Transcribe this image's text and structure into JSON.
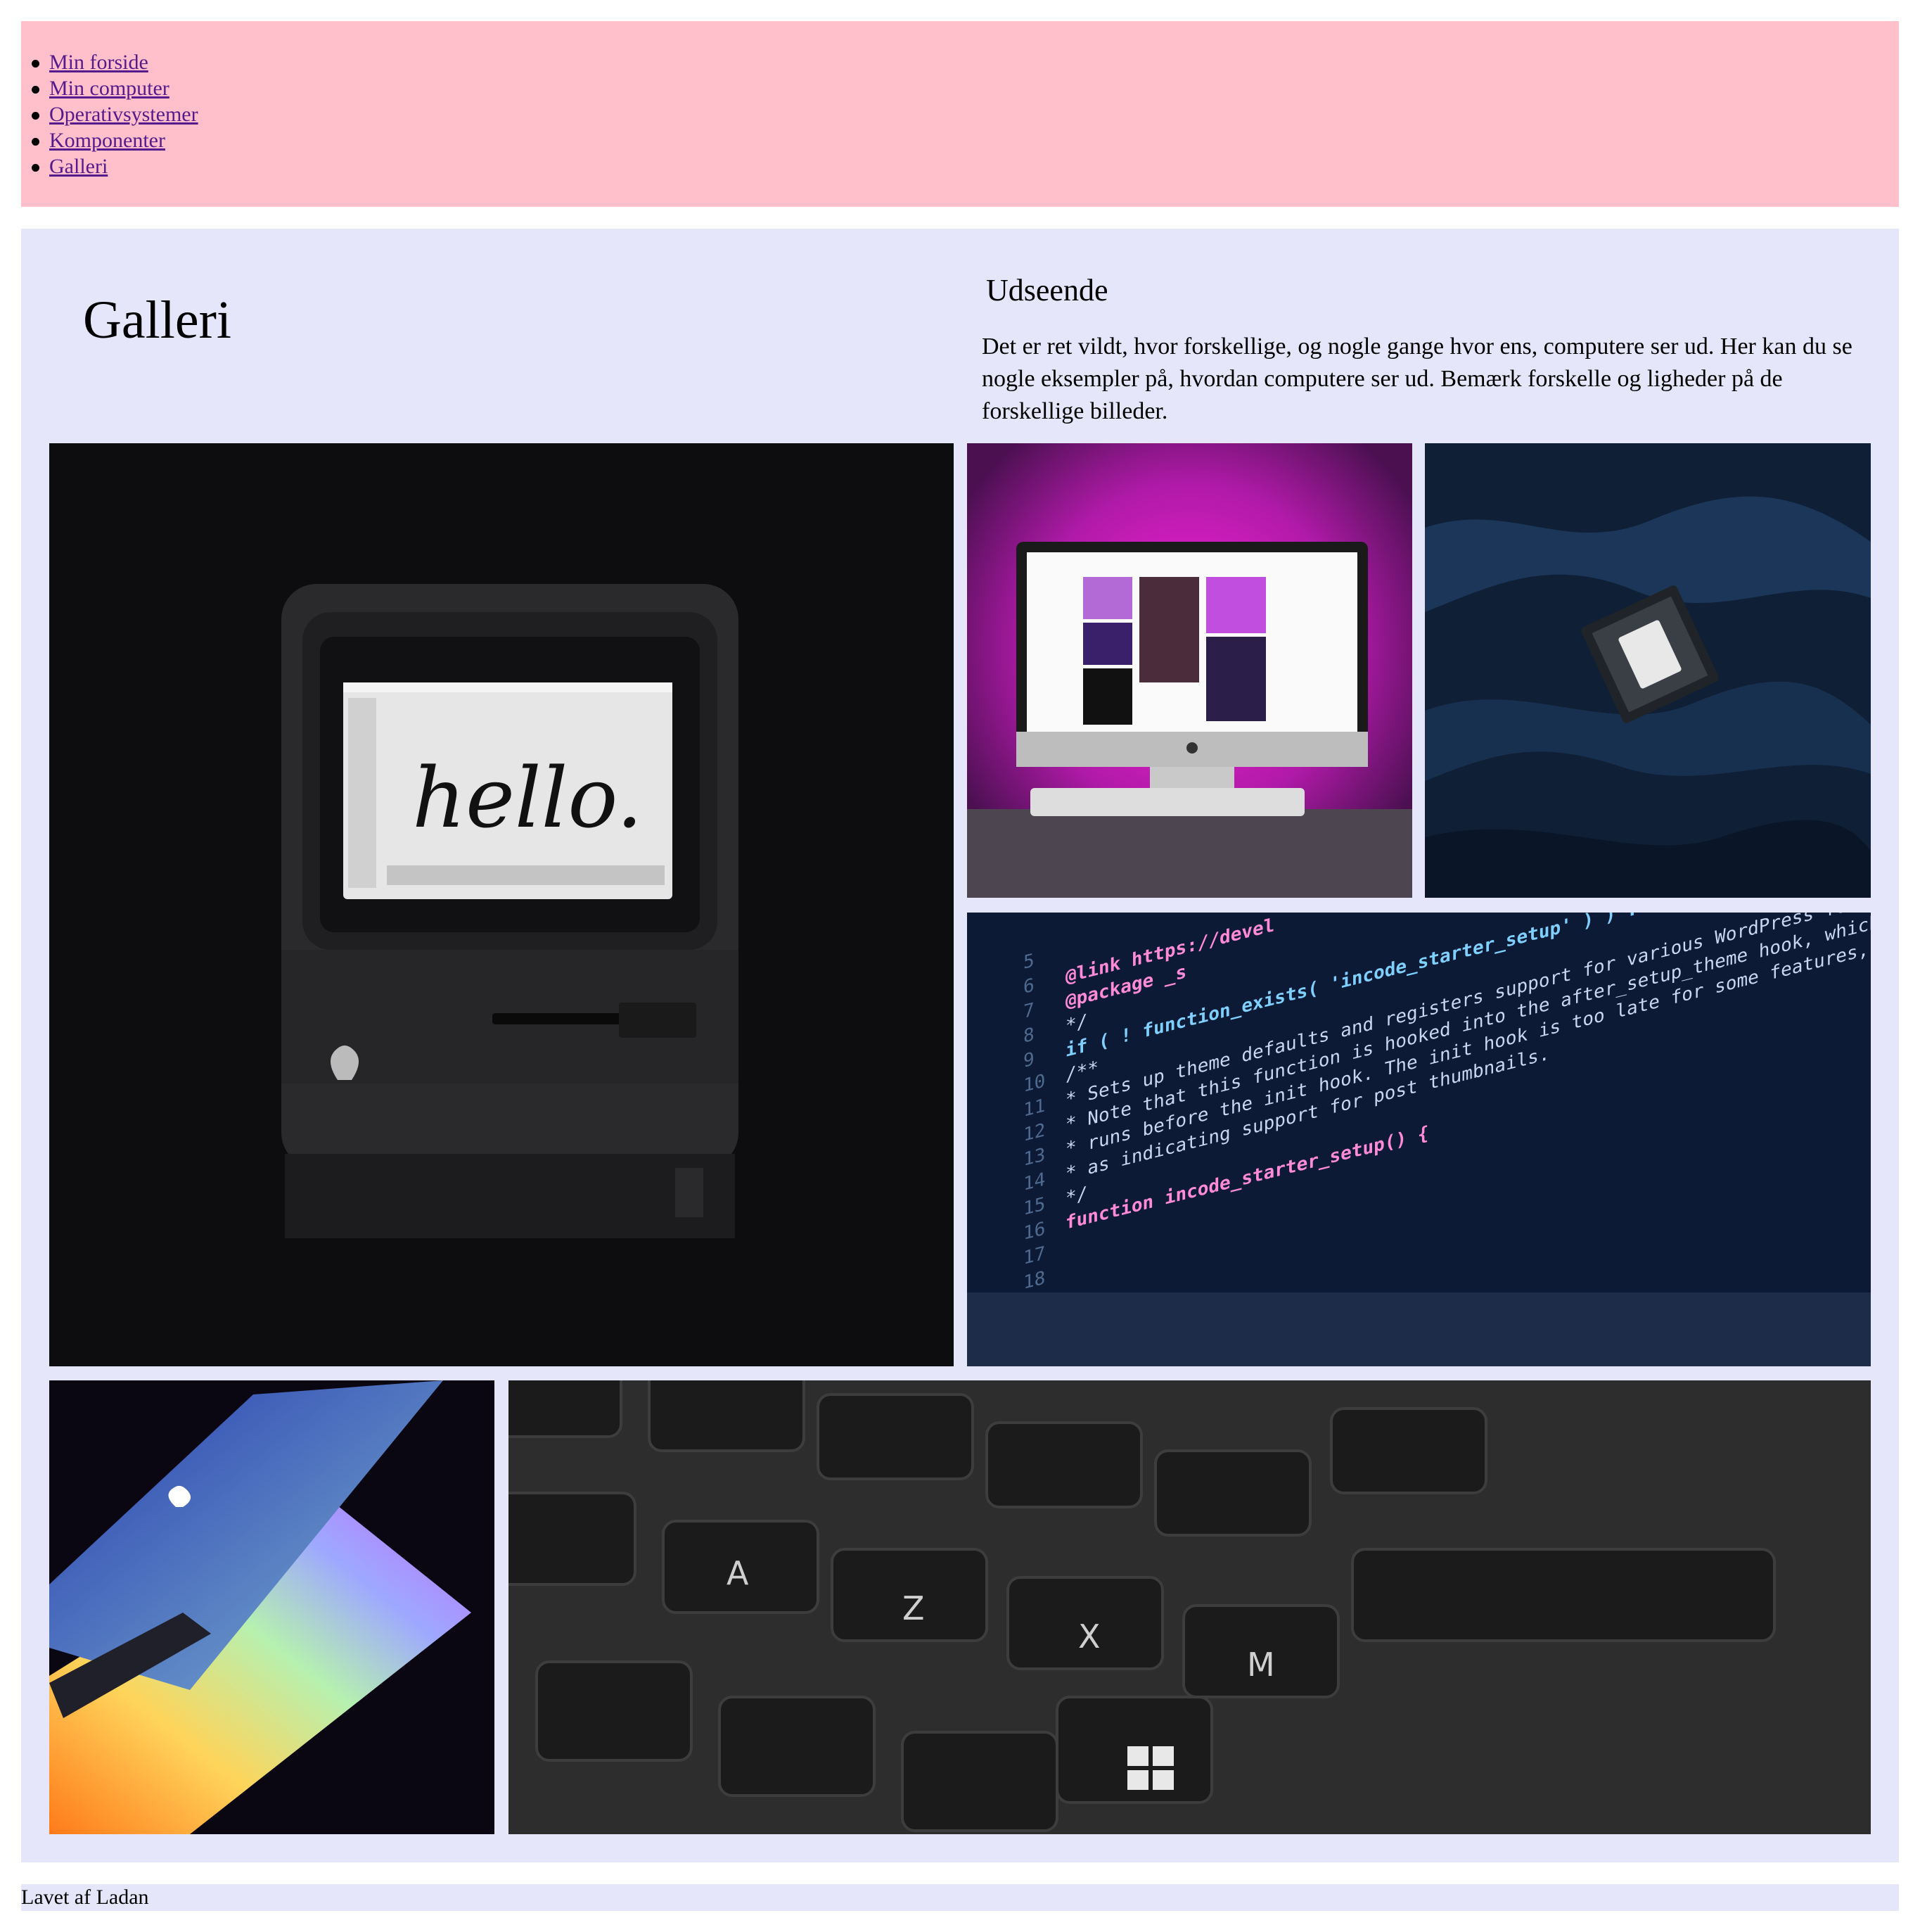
{
  "nav": {
    "items": [
      {
        "label": "Min forside"
      },
      {
        "label": "Min computer"
      },
      {
        "label": "Operativsystemer"
      },
      {
        "label": "Komponenter"
      },
      {
        "label": "Galleri"
      }
    ]
  },
  "main": {
    "title": "Galleri",
    "subtitle": "Udseende",
    "intro": "Det er ret vildt, hvor forskellige, og nogle gange hvor ens, computere ser ud. Her kan du se nogle eksempler på, hvordan computere ser ud. Bemærk forskelle og ligheder på de forskellige billeder."
  },
  "gallery": {
    "mac_screen_text": "hello.",
    "code_lines": [
      "@link https://devel",
      "@package _s",
      "*/",
      "if ( ! function_exists( 'incode_starter_setup' ) ) :",
      "/**",
      " * Sets up theme defaults and registers support for various WordPress feat",
      " * Note that this function is hooked into the after_setup_theme hook, which",
      " * runs before the init hook. The init hook is too late for some features,",
      " * as indicating support for post thumbnails.",
      " */",
      "function incode_starter_setup() {"
    ],
    "line_numbers": [
      "5",
      "6",
      "7",
      "8",
      "9",
      "10",
      "11",
      "12",
      "13",
      "14",
      "15",
      "16",
      "17",
      "18"
    ],
    "keys": [
      "A",
      "Z",
      "X",
      "M"
    ]
  },
  "colors": {
    "nav_bg": "#ffc0cb",
    "main_bg": "#e6e6fa",
    "link": "#551a8b"
  },
  "footer": {
    "text": "Lavet af Ladan"
  }
}
